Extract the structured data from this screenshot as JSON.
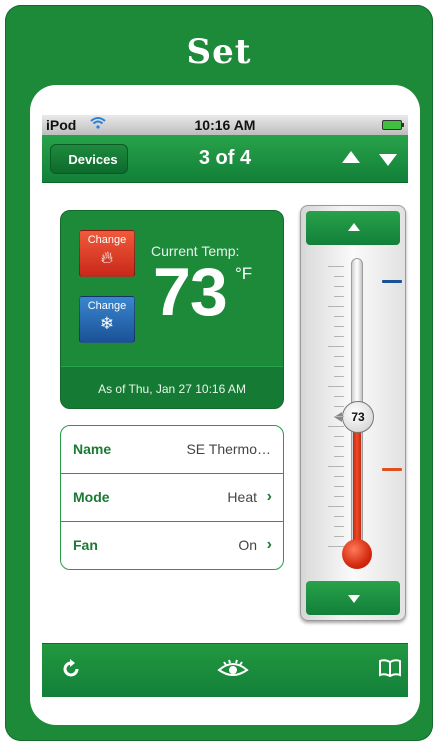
{
  "card": {
    "title": "Set"
  },
  "status_bar": {
    "carrier": "iPod",
    "time": "10:16 AM"
  },
  "nav_bar": {
    "back_label": "Devices",
    "title": "3 of 4"
  },
  "temperature": {
    "heat_button_label": "Change",
    "cool_button_label": "Change",
    "current_label": "Current Temp:",
    "value": "73",
    "unit": "°F",
    "as_of": "As of Thu, Jan 27 10:16 AM"
  },
  "settings": [
    {
      "label": "Name",
      "value": "SE Thermo…"
    },
    {
      "label": "Mode",
      "value": "Heat"
    },
    {
      "label": "Fan",
      "value": "On"
    }
  ],
  "thermometer": {
    "current_value": "73",
    "current_fraction": 0.46,
    "cool_setpoint_fraction": 0.95,
    "heat_setpoint_fraction": 0.28,
    "cool_color": "#1a5296",
    "heat_color": "#e0501e"
  },
  "tab_bar": {
    "icons": [
      "refresh-icon",
      "eye-icon",
      "book-icon"
    ]
  }
}
